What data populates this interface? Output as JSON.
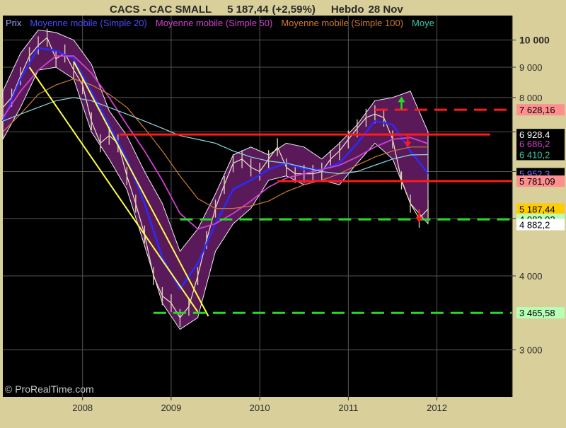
{
  "header": {
    "symbol": "CACS - CAC SMALL",
    "price": "5 187,44",
    "change": "(+2,59%)",
    "period": "Hebdo",
    "date": "28 Nov"
  },
  "legend": [
    {
      "label": "Prix",
      "color": "#9fa3ff"
    },
    {
      "label": "Moyenne mobile (Simple 20)",
      "color": "#4b4bff"
    },
    {
      "label": "Moyenne mobile (Simple 50)",
      "color": "#d040d0"
    },
    {
      "label": "Moyenne mobile (Simple 100)",
      "color": "#d07a30"
    },
    {
      "label": "Moye",
      "color": "#39c8a8"
    }
  ],
  "watermark": "© ProRealTime.com",
  "colors": {
    "background": "#000000",
    "frame": "#d9cf9a",
    "grid": "#555555",
    "band": "#5a1a5a",
    "ma20": "#2a2aff",
    "ma50": "#d040d0",
    "ma100": "#d07a30",
    "ma200": "#8fd8e0",
    "trend": "#ffff44",
    "resistance": "#ff1a1a",
    "support": "#22dd22"
  },
  "chart_data": {
    "type": "line",
    "yscale": "log",
    "ylim": [
      2500,
      11000
    ],
    "xlim": [
      2007.1,
      2012.85
    ],
    "y_ticks": [
      {
        "value": 10000,
        "label": "10 000"
      },
      {
        "value": 9000,
        "label": "9 000"
      },
      {
        "value": 8000,
        "label": "8 000"
      },
      {
        "value": 7000,
        "label": "7 000"
      },
      {
        "value": 6000,
        "label": "6 000"
      },
      {
        "value": 5000,
        "label": "5 000"
      },
      {
        "value": 4000,
        "label": "4 000"
      },
      {
        "value": 3000,
        "label": "3 000"
      }
    ],
    "x_ticks": [
      {
        "value": 2008,
        "label": "2008"
      },
      {
        "value": 2009,
        "label": "2009"
      },
      {
        "value": 2010,
        "label": "2010"
      },
      {
        "value": 2011,
        "label": "2011"
      },
      {
        "value": 2012,
        "label": "2012"
      }
    ],
    "price_labels": [
      {
        "value": 7628.16,
        "label": "7 628,16",
        "bg": "#ff8f8f",
        "fg": "#000000"
      },
      {
        "value": 6928.4,
        "label": "6 928,4",
        "bg": "#000000",
        "fg": "#ffffff"
      },
      {
        "value": 6686.2,
        "label": "6 686,2",
        "bg": "#000000",
        "fg": "#d040d0"
      },
      {
        "value": 6410.2,
        "label": "6 410,2",
        "bg": "#000000",
        "fg": "#39c8a8"
      },
      {
        "value": 5952.3,
        "label": "5 952,3",
        "bg": "#000000",
        "fg": "#6a6aff"
      },
      {
        "value": 5781.09,
        "label": "5 781,09",
        "bg": "#ff8f8f",
        "fg": "#000000"
      },
      {
        "value": 5187.44,
        "label": "5 187,44",
        "bg": "#ffcc00",
        "fg": "#000000"
      },
      {
        "value": 4983.02,
        "label": "4 983,02",
        "bg": "#b7ffb7",
        "fg": "#000000"
      },
      {
        "value": 4882.2,
        "label": "4 882,2",
        "bg": "#ffffff",
        "fg": "#000000"
      },
      {
        "value": 3465.58,
        "label": "3 465,58",
        "bg": "#b7ffb7",
        "fg": "#000000"
      }
    ],
    "series": [
      {
        "name": "Prix",
        "role": "price",
        "x": [
          2007.1,
          2007.2,
          2007.3,
          2007.4,
          2007.5,
          2007.6,
          2007.7,
          2007.8,
          2007.9,
          2008.0,
          2008.1,
          2008.2,
          2008.3,
          2008.4,
          2008.5,
          2008.6,
          2008.7,
          2008.8,
          2008.9,
          2009.0,
          2009.1,
          2009.2,
          2009.3,
          2009.4,
          2009.5,
          2009.6,
          2009.7,
          2009.8,
          2009.9,
          2010.0,
          2010.1,
          2010.2,
          2010.3,
          2010.4,
          2010.5,
          2010.6,
          2010.7,
          2010.8,
          2010.9,
          2011.0,
          2011.1,
          2011.2,
          2011.3,
          2011.4,
          2011.5,
          2011.6,
          2011.7,
          2011.8,
          2011.9
        ],
        "y": [
          7700,
          8000,
          8700,
          9400,
          9800,
          10100,
          9300,
          9500,
          8900,
          8400,
          7300,
          6700,
          6900,
          6700,
          5900,
          5300,
          4700,
          4000,
          3700,
          3600,
          3400,
          3550,
          4000,
          4600,
          5200,
          5700,
          6200,
          6300,
          6100,
          6000,
          6300,
          6600,
          6100,
          5950,
          5950,
          5950,
          6000,
          6300,
          6500,
          6800,
          7100,
          7400,
          7500,
          7400,
          6800,
          5800,
          5300,
          5000,
          5187.44
        ]
      },
      {
        "name": "Moyenne mobile (Simple 20)",
        "role": "ma20",
        "x": [
          2007.1,
          2007.3,
          2007.5,
          2007.7,
          2007.9,
          2008.1,
          2008.3,
          2008.5,
          2008.7,
          2008.9,
          2009.1,
          2009.3,
          2009.5,
          2009.7,
          2009.9,
          2010.1,
          2010.3,
          2010.5,
          2010.7,
          2010.9,
          2011.1,
          2011.3,
          2011.5,
          2011.7,
          2011.9
        ],
        "y": [
          7300,
          8600,
          9700,
          9600,
          9300,
          8200,
          7200,
          6300,
          5300,
          4300,
          3800,
          4200,
          4900,
          5600,
          5800,
          6050,
          6200,
          6050,
          6050,
          6200,
          6700,
          7300,
          7200,
          6500,
          5952.3
        ]
      },
      {
        "name": "Moyenne mobile (Simple 50)",
        "role": "ma50",
        "x": [
          2007.1,
          2007.3,
          2007.5,
          2007.7,
          2007.9,
          2008.1,
          2008.3,
          2008.5,
          2008.7,
          2008.9,
          2009.1,
          2009.3,
          2009.5,
          2009.7,
          2009.9,
          2010.1,
          2010.3,
          2010.5,
          2010.7,
          2010.9,
          2011.1,
          2011.3,
          2011.5,
          2011.7,
          2011.9
        ],
        "y": [
          7400,
          8200,
          8900,
          9400,
          9400,
          8800,
          8000,
          7200,
          6500,
          5800,
          5100,
          4800,
          4900,
          5100,
          5350,
          5650,
          5850,
          5950,
          6050,
          6150,
          6350,
          6600,
          6800,
          6850,
          6686.2
        ]
      },
      {
        "name": "Moyenne mobile (Simple 100)",
        "role": "ma100",
        "x": [
          2007.1,
          2007.3,
          2007.5,
          2007.7,
          2007.9,
          2008.1,
          2008.3,
          2008.5,
          2008.7,
          2008.9,
          2009.1,
          2009.3,
          2009.5,
          2009.7,
          2009.9,
          2010.1,
          2010.3,
          2010.5,
          2010.7,
          2010.9,
          2011.1,
          2011.3,
          2011.5,
          2011.7,
          2011.9
        ],
        "y": [
          7000,
          7500,
          8100,
          8400,
          8600,
          8400,
          8100,
          7700,
          7100,
          6500,
          5900,
          5400,
          5200,
          5200,
          5250,
          5350,
          5550,
          5700,
          5800,
          5950,
          6150,
          6350,
          6500,
          6600,
          6600
        ]
      },
      {
        "name": "Moye",
        "role": "ma200",
        "x": [
          2007.1,
          2007.3,
          2007.5,
          2007.7,
          2007.9,
          2008.1,
          2008.3,
          2008.5,
          2008.7,
          2008.9,
          2009.1,
          2009.3,
          2009.5,
          2009.7,
          2009.9,
          2010.1,
          2010.3,
          2010.5,
          2010.7,
          2010.9,
          2011.1,
          2011.3,
          2011.5,
          2011.7,
          2011.9
        ],
        "y": [
          7300,
          7500,
          7700,
          7900,
          8000,
          7900,
          7700,
          7500,
          7300,
          7100,
          6900,
          6800,
          6700,
          6500,
          6350,
          6250,
          6200,
          6100,
          6000,
          5950,
          6000,
          6150,
          6300,
          6400,
          6410.2
        ]
      }
    ],
    "band": {
      "x": [
        2007.1,
        2007.3,
        2007.5,
        2007.7,
        2007.9,
        2008.1,
        2008.3,
        2008.5,
        2008.7,
        2008.9,
        2009.1,
        2009.3,
        2009.5,
        2009.7,
        2009.9,
        2010.1,
        2010.3,
        2010.5,
        2010.7,
        2010.9,
        2011.1,
        2011.3,
        2011.5,
        2011.7,
        2011.9
      ],
      "upper": [
        8200,
        9500,
        10400,
        10300,
        10000,
        9100,
        7600,
        6900,
        6000,
        5300,
        4400,
        4800,
        5500,
        6400,
        6600,
        6400,
        6700,
        6600,
        6300,
        6700,
        7200,
        7900,
        8000,
        8200,
        7000
      ],
      "lower": [
        6800,
        7700,
        8900,
        9000,
        8600,
        7000,
        6300,
        5600,
        4500,
        3600,
        3250,
        3400,
        4400,
        4900,
        5200,
        5800,
        5900,
        5700,
        5800,
        5700,
        6200,
        6700,
        6300,
        5300,
        4900
      ]
    },
    "trendlines": [
      {
        "role": "trend",
        "x": [
          2007.4,
          2009.3
        ],
        "y": [
          9000,
          3480
        ]
      },
      {
        "role": "trend",
        "x": [
          2007.9,
          2009.42
        ],
        "y": [
          9200,
          3420
        ]
      }
    ],
    "levels": [
      {
        "role": "resistance",
        "value": 7628.16,
        "x_from": 2011.3,
        "x_to": 2012.85,
        "dash": true
      },
      {
        "role": "resistance",
        "value": 6928.4,
        "x_from": 2008.42,
        "x_to": 2012.6,
        "dash": false
      },
      {
        "role": "resistance",
        "value": 5781.09,
        "x_from": 2010.2,
        "x_to": 2012.85,
        "dash": false
      },
      {
        "role": "support",
        "value": 4983.02,
        "x_from": 2009.1,
        "x_to": 2012.85,
        "dash": true
      },
      {
        "role": "support",
        "value": 3465.58,
        "x_from": 2008.8,
        "x_to": 2012.85,
        "dash": true
      }
    ],
    "arrows": [
      {
        "role": "up",
        "x": 2011.6,
        "y": 7900,
        "color": "#22dd22"
      },
      {
        "role": "down",
        "x": 2011.67,
        "y": 6700,
        "color": "#ff1a1a"
      },
      {
        "role": "down",
        "x": 2011.8,
        "y": 5000,
        "color": "#ff1a1a"
      }
    ]
  }
}
